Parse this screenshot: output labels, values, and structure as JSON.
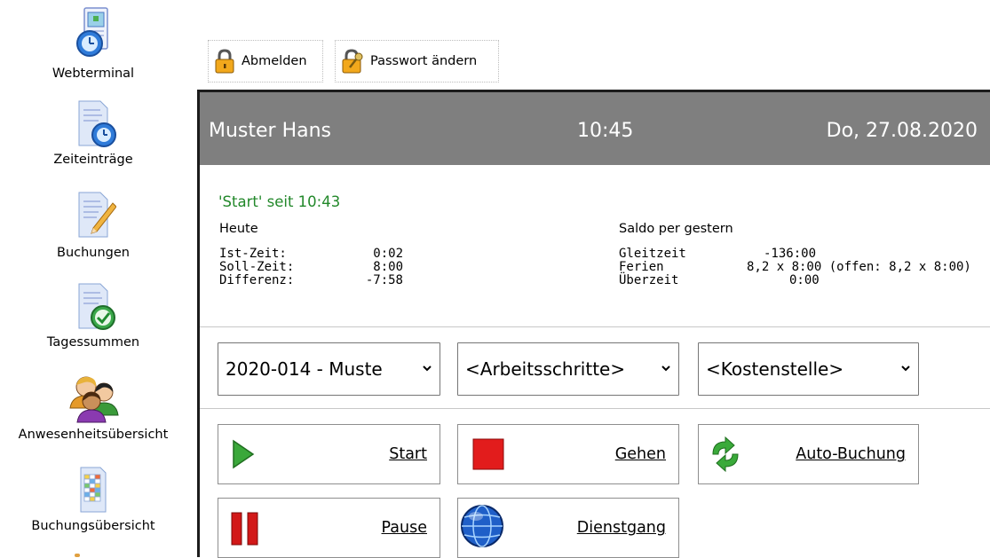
{
  "sidebar": {
    "items": [
      {
        "label": "Webterminal",
        "icon": "webterminal-icon"
      },
      {
        "label": "Zeiteinträge",
        "icon": "time-entries-icon"
      },
      {
        "label": "Buchungen",
        "icon": "bookings-icon"
      },
      {
        "label": "Tagessummen",
        "icon": "daily-totals-icon"
      },
      {
        "label": "Anwesenheitsübersicht",
        "icon": "attendance-icon"
      },
      {
        "label": "Buchungsübersicht",
        "icon": "booking-overview-icon"
      }
    ]
  },
  "toolbar": {
    "logout_label": "Abmelden",
    "change_password_label": "Passwort ändern"
  },
  "header": {
    "name": "Muster Hans",
    "time": "10:45",
    "date": "Do, 27.08.2020"
  },
  "status": {
    "current": "'Start' seit 10:43",
    "today": {
      "title": "Heute",
      "rows": [
        {
          "label": "Ist-Zeit:",
          "value": "0:02"
        },
        {
          "label": "Soll-Zeit:",
          "value": "8:00"
        },
        {
          "label": "Differenz:",
          "value": "-7:58"
        }
      ]
    },
    "balance": {
      "title": "Saldo per gestern",
      "rows": [
        {
          "label": "Gleitzeit",
          "value": "-136:00"
        },
        {
          "label": "Ferien",
          "value": "8,2 x 8:00 (offen: 8,2 x 8:00)"
        },
        {
          "label": "Überzeit",
          "value": "0:00"
        }
      ]
    }
  },
  "selects": {
    "project": "2020-014 - Muste",
    "work_steps": "<Arbeitsschritte>",
    "cost_center": "<Kostenstelle>"
  },
  "actions": {
    "start": "Start",
    "leave": "Gehen",
    "auto_booking": "Auto-Buchung",
    "pause": "Pause",
    "business_trip": "Dienstgang"
  },
  "colors": {
    "header_bg": "#7f7f7f",
    "status_green": "#22882a"
  }
}
